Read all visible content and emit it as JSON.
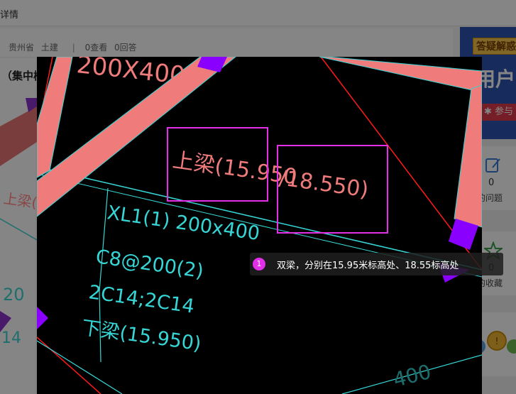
{
  "page": {
    "breadcrumb": "详情",
    "question_title": "（集中楼",
    "meta": {
      "province": "贵州省",
      "category": "土建",
      "views": "0查看",
      "answers": "0回答"
    }
  },
  "sidebar": {
    "banner_tag": "答疑解惑",
    "banner_text": "用户",
    "join_label": "参与",
    "stats": [
      {
        "count": "0",
        "label": "的问题"
      },
      {
        "count": "0",
        "label": "的收藏"
      }
    ]
  },
  "viewer": {
    "annotation_index": "1",
    "annotation_text": "双梁，分别在15.95米标高处、18.55标高处",
    "cad_texts": {
      "dim_top": "200X400",
      "upper_beam_a": "上梁(15.950",
      "upper_beam_b": "/18.550)",
      "xl_label": "XL1(1) 200x400",
      "stirrup": "C8@200(2)",
      "rebar": "2C14;2C14",
      "lower_beam": "下梁(15.950)",
      "dim_bottom": "400",
      "left_upper": "上梁(1",
      "left_200": "20",
      "left_14": "14"
    },
    "colors": {
      "beam": "#f07b7b",
      "outline": "#36d6d6",
      "column": "#8a00ff",
      "axis": "#ff1a1a",
      "highlight": "#e32fe8"
    }
  }
}
